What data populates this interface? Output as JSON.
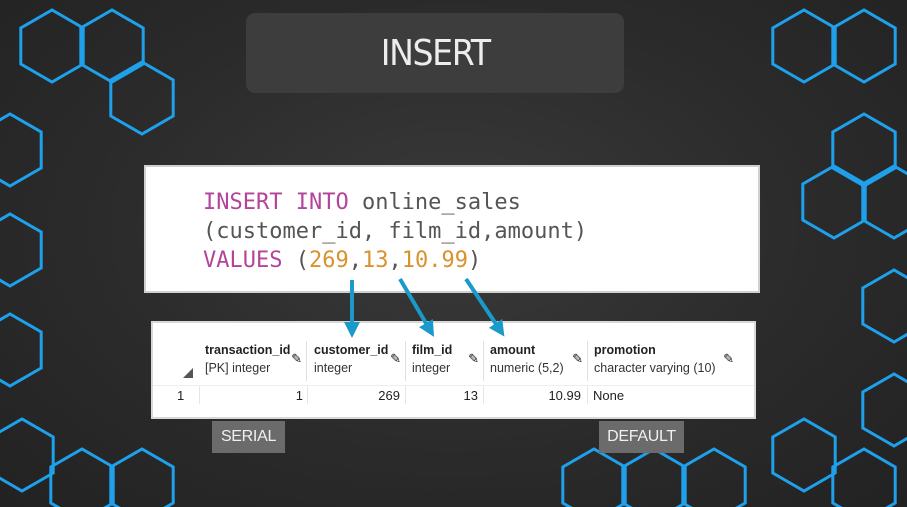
{
  "slide": {
    "title": "INSERT",
    "accent_color": "#1ea0ea",
    "arrow_color": "#1a9acb"
  },
  "sql": {
    "line1_kw": "INSERT INTO",
    "line1_rest": " online_sales",
    "line2": "(customer_id, film_id,amount)",
    "line3_kw": "VALUES",
    "line3_open": " (",
    "val1": "269",
    "sep1": ",",
    "val2": "13",
    "sep2": ",",
    "val3": "10.99",
    "line3_close": ")"
  },
  "grid": {
    "columns": [
      {
        "name": "transaction_id",
        "type": "[PK] integer"
      },
      {
        "name": "customer_id",
        "type": "integer"
      },
      {
        "name": "film_id",
        "type": "integer"
      },
      {
        "name": "amount",
        "type": "numeric (5,2)"
      },
      {
        "name": "promotion",
        "type": "character varying (10)"
      }
    ],
    "row": {
      "row_number": "1",
      "transaction_id": "1",
      "customer_id": "269",
      "film_id": "13",
      "amount": "10.99",
      "promotion": "None"
    }
  },
  "labels": {
    "serial": "SERIAL",
    "default": "DEFAULT"
  }
}
